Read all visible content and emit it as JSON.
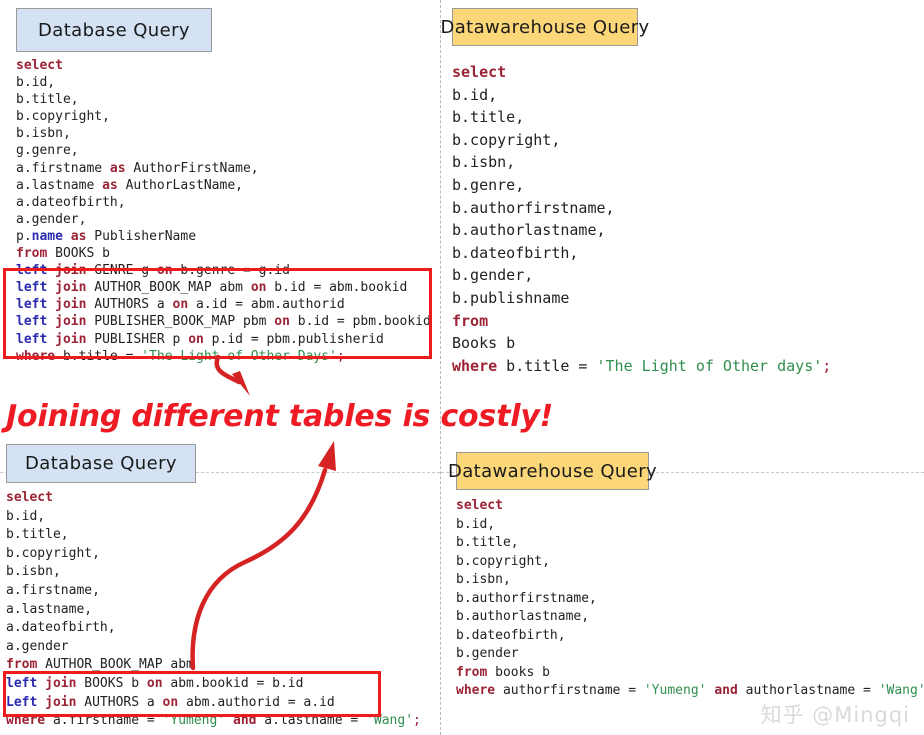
{
  "layout": {
    "background": "#ffffff",
    "divider_color": "#c0c0c0",
    "red_accent": "#ee1c1c",
    "chip_blue": "#d4e2f4",
    "chip_yellow": "#fbd779",
    "keyword_color": "#9b2335",
    "string_color": "#2f8f4e",
    "left_keyword_color": "#2b2bb0"
  },
  "headline": {
    "text": "Joining different tables is costly!",
    "color": "#ee1b24"
  },
  "watermark": {
    "text": "知乎 @Mingqi"
  },
  "panels": {
    "top_left": {
      "chip_label": "Database Query",
      "chip_style": "blue",
      "code_lines": [
        "select",
        "b.id,",
        "b.title,",
        "b.copyright,",
        "b.isbn,",
        "g.genre,",
        "a.firstname as AuthorFirstName,",
        "a.lastname as AuthorLastName,",
        "a.dateofbirth,",
        "a.gender,",
        "p.name as PublisherName",
        "from BOOKS b",
        "left join GENRE g on b.genre = g.id",
        "left join AUTHOR_BOOK_MAP abm on b.id = abm.bookid",
        "left join AUTHORS a on a.id = abm.authorid",
        "left join PUBLISHER_BOOK_MAP pbm on b.id = pbm.bookid",
        "left join PUBLISHER p on p.id = pbm.publisherid",
        "where b.title = 'The Light of Other Days';"
      ],
      "highlighted_lines": [
        "left join GENRE g on b.genre = g.id",
        "left join AUTHOR_BOOK_MAP abm on b.id = abm.bookid",
        "left join AUTHORS a on a.id = abm.authorid",
        "left join PUBLISHER_BOOK_MAP pbm on b.id = pbm.bookid",
        "left join PUBLISHER p on p.id = pbm.publisherid"
      ]
    },
    "top_right": {
      "chip_label": "Datawarehouse Query",
      "chip_style": "yellow",
      "code_lines": [
        "select",
        "b.id,",
        "b.title,",
        "b.copyright,",
        "b.isbn,",
        "b.genre,",
        "b.authorfirstname,",
        "b.authorlastname,",
        "b.dateofbirth,",
        "b.gender,",
        "b.publishname",
        "from",
        "Books b",
        "where b.title = 'The Light of Other days';"
      ]
    },
    "bottom_left": {
      "chip_label": "Database Query",
      "chip_style": "blue",
      "code_lines": [
        "select",
        "b.id,",
        "b.title,",
        "b.copyright,",
        "b.isbn,",
        "a.firstname,",
        "a.lastname,",
        "a.dateofbirth,",
        "a.gender",
        "from AUTHOR_BOOK_MAP abm",
        "left join BOOKS b on abm.bookid = b.id",
        "Left join AUTHORS a on abm.authorid = a.id",
        "where a.firstname = 'Yumeng' and a.lastname = 'Wang';"
      ],
      "highlighted_lines": [
        "left join BOOKS b on abm.bookid = b.id",
        "Left join AUTHORS a on abm.authorid = a.id"
      ]
    },
    "bottom_right": {
      "chip_label": "Datawarehouse Query",
      "chip_style": "yellow",
      "code_lines": [
        "select",
        "b.id,",
        "b.title,",
        "b.copyright,",
        "b.isbn,",
        "b.authorfirstname,",
        "b.authorlastname,",
        "b.dateofbirth,",
        "b.gender",
        "from books b",
        "where authorfirstname = 'Yumeng' and authorlastname = 'Wang'"
      ]
    }
  },
  "annotations": {
    "arrow_down_label": "small-curved-arrow-down",
    "arrow_up_label": "large-s-curve-arrow-up"
  }
}
